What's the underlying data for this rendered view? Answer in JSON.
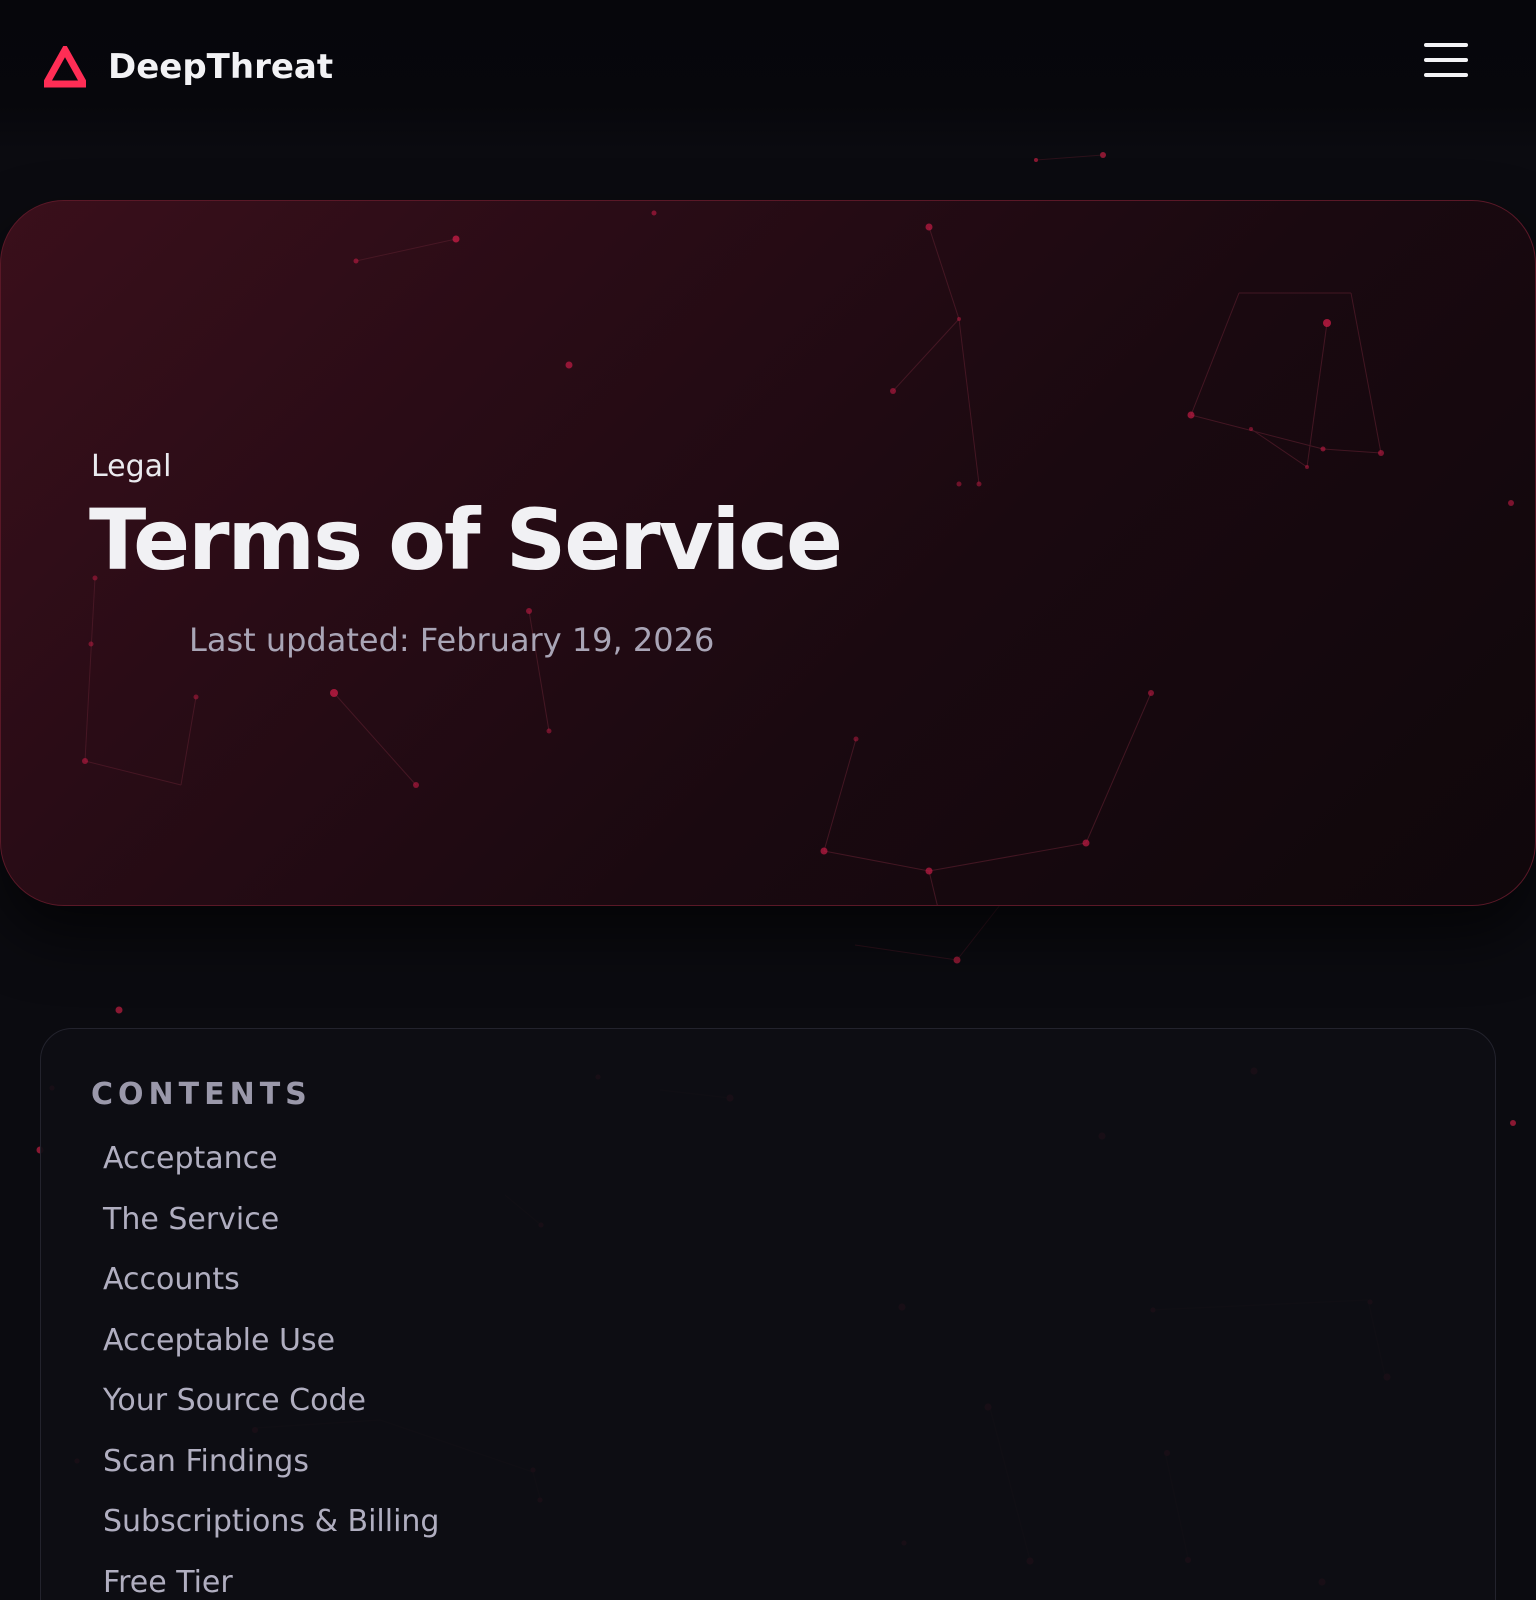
{
  "header": {
    "brand_name": "DeepThreat",
    "logo_icon": "triangle-warning-logo",
    "menu_icon": "hamburger-menu-icon",
    "accent_color": "#ff2d55"
  },
  "hero": {
    "eyebrow": "Legal",
    "title": "Terms of Service",
    "last_updated": "Last updated: February 19, 2026"
  },
  "contents": {
    "heading": "CONTENTS",
    "items": [
      {
        "label": "Acceptance"
      },
      {
        "label": "The Service"
      },
      {
        "label": "Accounts"
      },
      {
        "label": "Acceptable Use"
      },
      {
        "label": "Your Source Code"
      },
      {
        "label": "Scan Findings"
      },
      {
        "label": "Subscriptions & Billing"
      },
      {
        "label": "Free Tier"
      }
    ]
  },
  "colors": {
    "background": "#0b0b10",
    "hero_gradient_start": "#3a0f1b",
    "hero_gradient_end": "#0f070b",
    "hero_border": "#5a1827",
    "node_color": "#c21b44"
  }
}
